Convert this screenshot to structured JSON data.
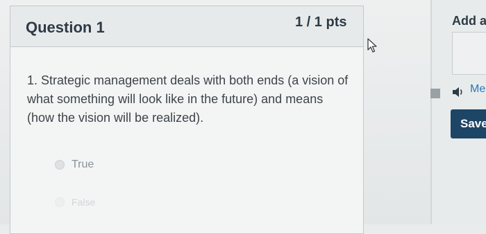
{
  "question": {
    "title": "Question 1",
    "points": "1 / 1 pts",
    "text": "1. Strategic management deals with both ends (a vision of what something will look like in the future) and means (how the vision will be realized).",
    "answers": [
      {
        "label": "True"
      },
      {
        "label": "False"
      }
    ]
  },
  "sidebar": {
    "add_label": "Add a",
    "media_label": "Me",
    "media_icon": "speaker-icon",
    "save_label": "Save"
  },
  "colors": {
    "text_dark": "#2d3b45",
    "save_button": "#1d4566",
    "link": "#2a77b5"
  }
}
